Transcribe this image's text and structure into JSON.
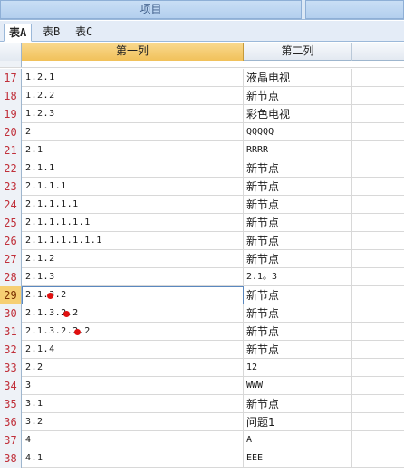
{
  "header": {
    "title": "项目",
    "right_title": ""
  },
  "tabs": [
    {
      "label": "表A",
      "active": true
    },
    {
      "label": "表B",
      "active": false
    },
    {
      "label": "表C",
      "active": false
    }
  ],
  "columns": [
    "第一列",
    "第二列"
  ],
  "selected_row": "29",
  "marker_color": "#e01010",
  "rows": [
    {
      "num": "17",
      "c1": "1.2.1",
      "c2": "液晶电视"
    },
    {
      "num": "18",
      "c1": "1.2.2",
      "c2": "新节点"
    },
    {
      "num": "19",
      "c1": "1.2.3",
      "c2": "彩色电视"
    },
    {
      "num": "20",
      "c1": "2",
      "c2": "QQQQQ"
    },
    {
      "num": "21",
      "c1": "2.1",
      "c2": "RRRR"
    },
    {
      "num": "22",
      "c1": "2.1.1",
      "c2": "新节点"
    },
    {
      "num": "23",
      "c1": "2.1.1.1",
      "c2": "新节点"
    },
    {
      "num": "24",
      "c1": "2.1.1.1.1",
      "c2": "新节点"
    },
    {
      "num": "25",
      "c1": "2.1.1.1.1.1",
      "c2": "新节点"
    },
    {
      "num": "26",
      "c1": "2.1.1.1.1.1.1",
      "c2": "新节点"
    },
    {
      "num": "27",
      "c1": "2.1.2",
      "c2": "新节点"
    },
    {
      "num": "28",
      "c1": "2.1.3",
      "c2": "2.1。3"
    },
    {
      "num": "29",
      "c1": "2.1.3.2",
      "c2": "新节点",
      "marker": true
    },
    {
      "num": "30",
      "c1": "2.1.3.2.2",
      "c2": "新节点",
      "marker": true
    },
    {
      "num": "31",
      "c1": "2.1.3.2.2.2",
      "c2": "新节点",
      "marker": true
    },
    {
      "num": "32",
      "c1": "2.1.4",
      "c2": "新节点"
    },
    {
      "num": "33",
      "c1": "2.2",
      "c2": "12"
    },
    {
      "num": "34",
      "c1": "3",
      "c2": "WWW"
    },
    {
      "num": "35",
      "c1": "3.1",
      "c2": "新节点"
    },
    {
      "num": "36",
      "c1": "3.2",
      "c2": "问题1"
    },
    {
      "num": "37",
      "c1": "4",
      "c2": "A"
    },
    {
      "num": "38",
      "c1": "4.1",
      "c2": "EEE"
    }
  ]
}
